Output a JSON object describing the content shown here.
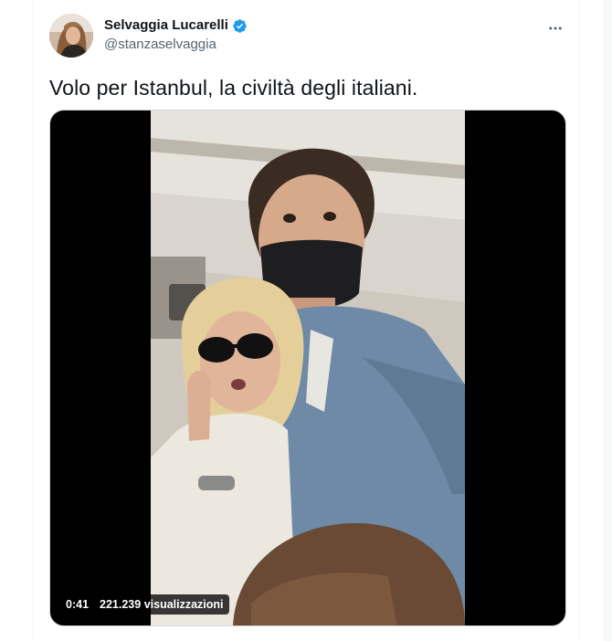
{
  "tweet": {
    "author": {
      "display_name": "Selvaggia Lucarelli",
      "handle": "@stanzaselvaggia",
      "verified": true
    },
    "text": "Volo per Istanbul, la civiltà degli italiani.",
    "media": {
      "type": "video",
      "duration": "0:41",
      "views": "221.239 visualizzazioni"
    },
    "more_icon": "more-horizontal-icon"
  },
  "colors": {
    "text_primary": "#0f1419",
    "text_secondary": "#536471",
    "verified_blue": "#1d9bf0",
    "border": "#eff3f4"
  }
}
